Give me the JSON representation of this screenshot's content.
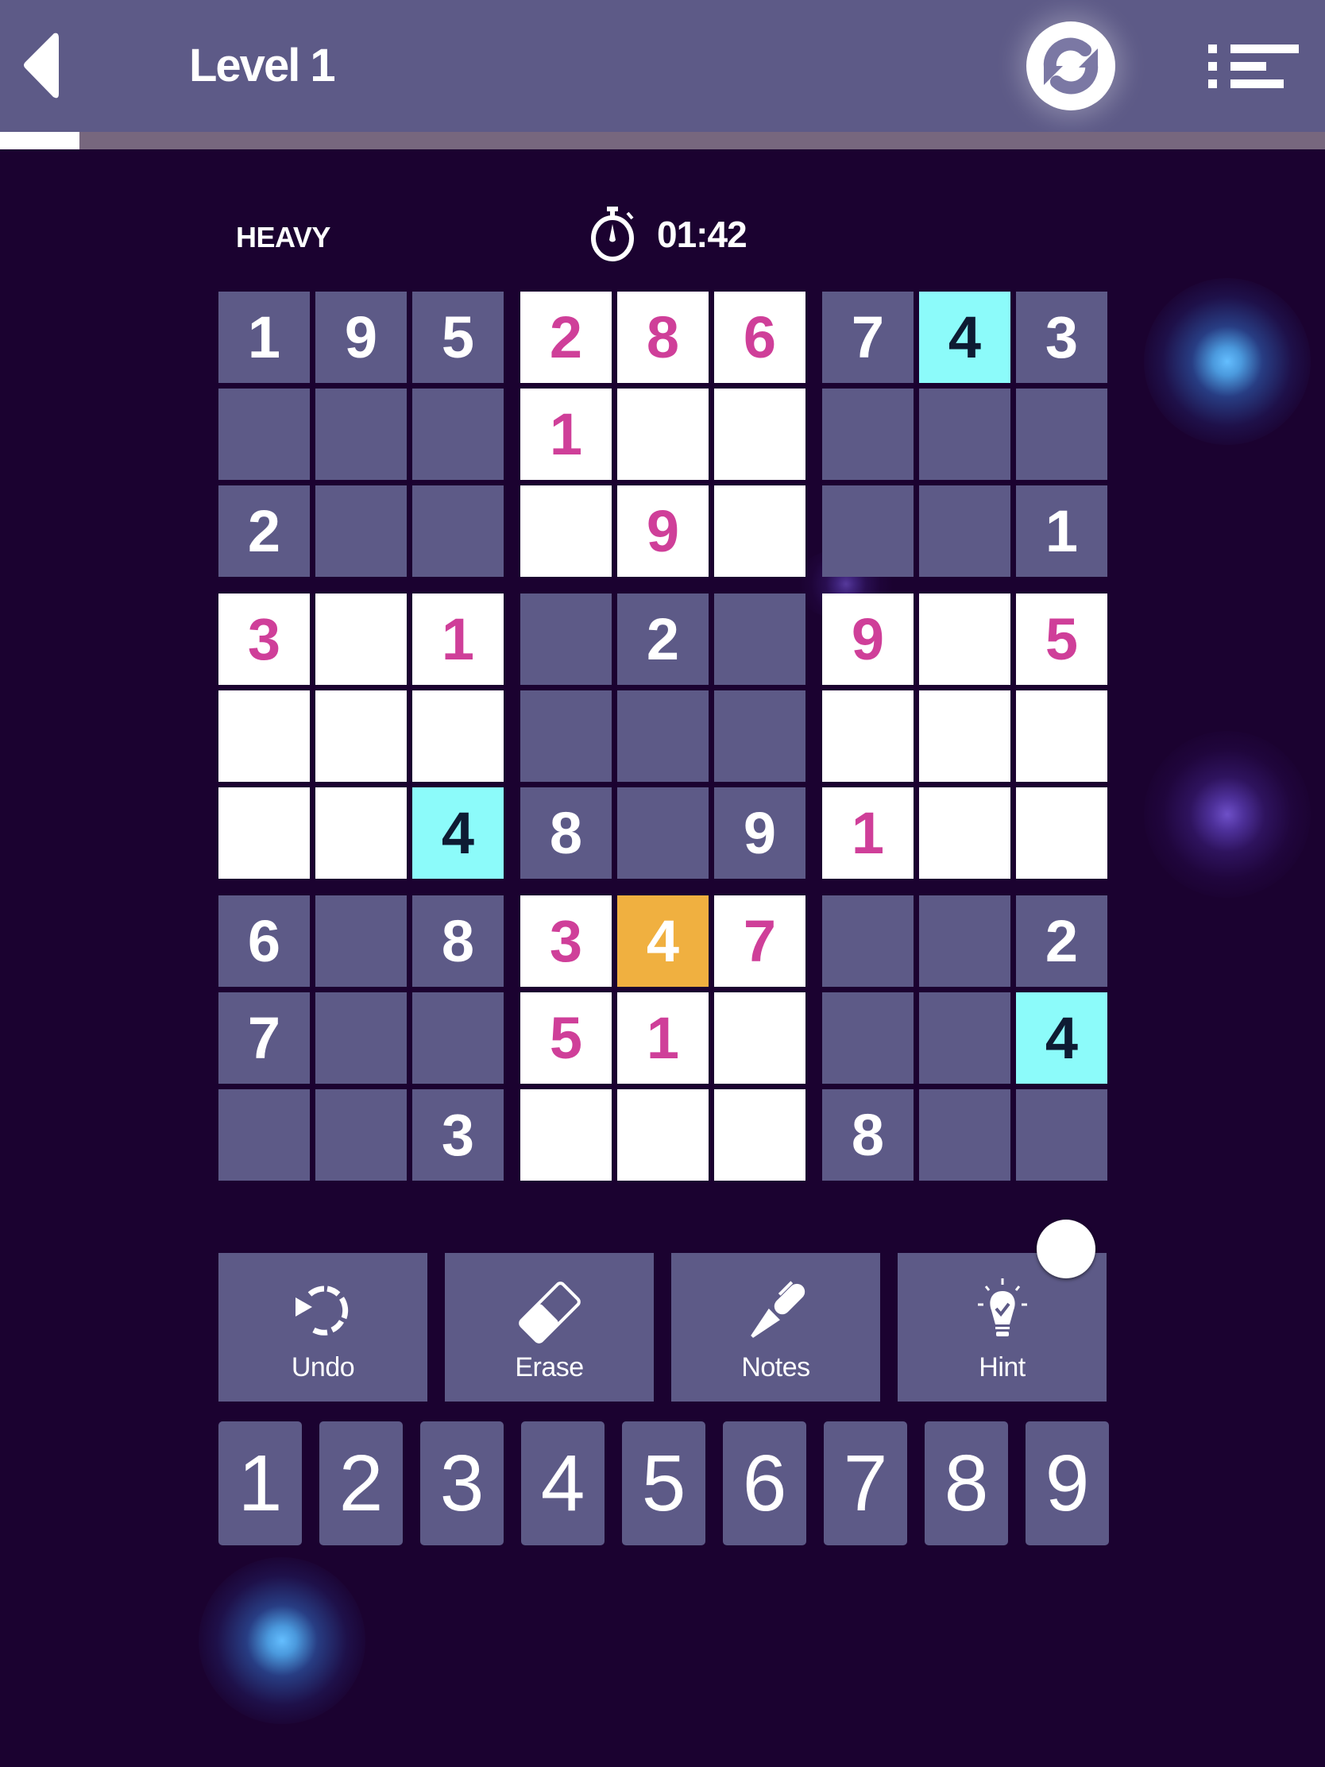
{
  "header": {
    "title": "Level 1",
    "back_icon": "back-arrow-icon",
    "restart_icon": "restart-icon",
    "menu_icon": "list-menu-icon",
    "level_progress_fraction": 0.06
  },
  "status": {
    "difficulty": "HEAVY",
    "timer": "01:42",
    "timer_icon": "stopwatch-icon"
  },
  "colors": {
    "background": "#1b0230",
    "header": "#5d5a87",
    "given_cell": "#5d5a87",
    "open_cell": "#ffffff",
    "entered_digit": "#cf3f99",
    "highlight_cell": "#8cfbfa",
    "selected_cell": "#f0b040"
  },
  "board": {
    "rows": [
      [
        {
          "v": "1",
          "t": "given"
        },
        {
          "v": "9",
          "t": "given"
        },
        {
          "v": "5",
          "t": "given"
        },
        {
          "v": "2",
          "t": "open"
        },
        {
          "v": "8",
          "t": "open"
        },
        {
          "v": "6",
          "t": "open"
        },
        {
          "v": "7",
          "t": "given"
        },
        {
          "v": "4",
          "t": "highlight"
        },
        {
          "v": "3",
          "t": "given"
        }
      ],
      [
        {
          "v": "",
          "t": "given"
        },
        {
          "v": "",
          "t": "given"
        },
        {
          "v": "",
          "t": "given"
        },
        {
          "v": "1",
          "t": "open"
        },
        {
          "v": "",
          "t": "open"
        },
        {
          "v": "",
          "t": "open"
        },
        {
          "v": "",
          "t": "given"
        },
        {
          "v": "",
          "t": "given"
        },
        {
          "v": "",
          "t": "given"
        }
      ],
      [
        {
          "v": "2",
          "t": "given"
        },
        {
          "v": "",
          "t": "given"
        },
        {
          "v": "",
          "t": "given"
        },
        {
          "v": "",
          "t": "open"
        },
        {
          "v": "9",
          "t": "open"
        },
        {
          "v": "",
          "t": "open"
        },
        {
          "v": "",
          "t": "given"
        },
        {
          "v": "",
          "t": "given"
        },
        {
          "v": "1",
          "t": "given"
        }
      ],
      [
        {
          "v": "3",
          "t": "open"
        },
        {
          "v": "",
          "t": "open"
        },
        {
          "v": "1",
          "t": "open"
        },
        {
          "v": "",
          "t": "given"
        },
        {
          "v": "2",
          "t": "given"
        },
        {
          "v": "",
          "t": "given"
        },
        {
          "v": "9",
          "t": "open"
        },
        {
          "v": "",
          "t": "open"
        },
        {
          "v": "5",
          "t": "open"
        }
      ],
      [
        {
          "v": "",
          "t": "open"
        },
        {
          "v": "",
          "t": "open"
        },
        {
          "v": "",
          "t": "open"
        },
        {
          "v": "",
          "t": "given"
        },
        {
          "v": "",
          "t": "given"
        },
        {
          "v": "",
          "t": "given"
        },
        {
          "v": "",
          "t": "open"
        },
        {
          "v": "",
          "t": "open"
        },
        {
          "v": "",
          "t": "open"
        }
      ],
      [
        {
          "v": "",
          "t": "open"
        },
        {
          "v": "",
          "t": "open"
        },
        {
          "v": "4",
          "t": "highlight"
        },
        {
          "v": "8",
          "t": "given"
        },
        {
          "v": "",
          "t": "given"
        },
        {
          "v": "9",
          "t": "given"
        },
        {
          "v": "1",
          "t": "open"
        },
        {
          "v": "",
          "t": "open"
        },
        {
          "v": "",
          "t": "open"
        }
      ],
      [
        {
          "v": "6",
          "t": "given"
        },
        {
          "v": "",
          "t": "given"
        },
        {
          "v": "8",
          "t": "given"
        },
        {
          "v": "3",
          "t": "open"
        },
        {
          "v": "4",
          "t": "selected"
        },
        {
          "v": "7",
          "t": "open"
        },
        {
          "v": "",
          "t": "given"
        },
        {
          "v": "",
          "t": "given"
        },
        {
          "v": "2",
          "t": "given"
        }
      ],
      [
        {
          "v": "7",
          "t": "given"
        },
        {
          "v": "",
          "t": "given"
        },
        {
          "v": "",
          "t": "given"
        },
        {
          "v": "5",
          "t": "open"
        },
        {
          "v": "1",
          "t": "open"
        },
        {
          "v": "",
          "t": "open"
        },
        {
          "v": "",
          "t": "given"
        },
        {
          "v": "",
          "t": "given"
        },
        {
          "v": "4",
          "t": "highlight"
        }
      ],
      [
        {
          "v": "",
          "t": "given"
        },
        {
          "v": "",
          "t": "given"
        },
        {
          "v": "3",
          "t": "given"
        },
        {
          "v": "",
          "t": "open"
        },
        {
          "v": "",
          "t": "open"
        },
        {
          "v": "",
          "t": "open"
        },
        {
          "v": "8",
          "t": "given"
        },
        {
          "v": "",
          "t": "given"
        },
        {
          "v": "",
          "t": "given"
        }
      ]
    ]
  },
  "tools": [
    {
      "id": "undo",
      "label": "Undo",
      "icon": "undo-icon"
    },
    {
      "id": "erase",
      "label": "Erase",
      "icon": "eraser-icon"
    },
    {
      "id": "notes",
      "label": "Notes",
      "icon": "pen-icon"
    },
    {
      "id": "hint",
      "label": "Hint",
      "icon": "lightbulb-icon"
    }
  ],
  "number_pad": [
    "1",
    "2",
    "3",
    "4",
    "5",
    "6",
    "7",
    "8",
    "9"
  ]
}
